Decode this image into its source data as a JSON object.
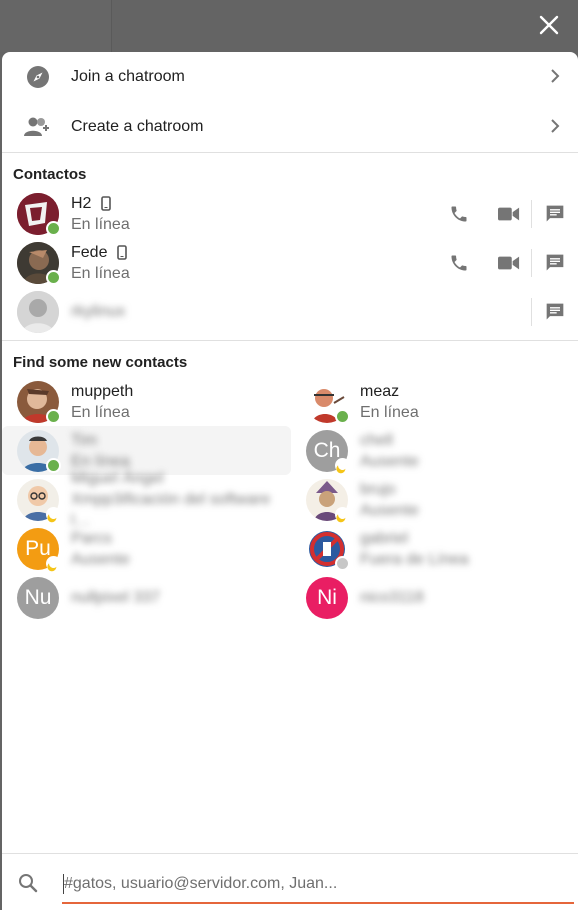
{
  "window": {
    "close_icon": "close-icon"
  },
  "actions": [
    {
      "label": "Join a chatroom",
      "icon": "compass-icon"
    },
    {
      "label": "Create a chatroom",
      "icon": "add-group-icon"
    }
  ],
  "contacts": {
    "title": "Contactos",
    "items": [
      {
        "name": "H2",
        "status_text": "En línea",
        "status": "online",
        "mobile": true,
        "avatar_color": "#7b1e2e"
      },
      {
        "name": "Fede",
        "status_text": "En línea",
        "status": "online",
        "mobile": true,
        "avatar_color": "#5a4a3a"
      },
      {
        "name": "rkylinux",
        "status_text": "",
        "status": "none",
        "mobile": false,
        "avatar_color": "#b5b5b5"
      }
    ]
  },
  "new_contacts": {
    "title": "Find some new contacts",
    "items": [
      {
        "name": "muppeth",
        "status_text": "En línea",
        "status": "online",
        "avatar_text": "",
        "avatar_color": "#8a5a3c",
        "blurred": false
      },
      {
        "name": "meaz",
        "status_text": "En línea",
        "status": "online",
        "avatar_text": "",
        "avatar_color": "#f0e6dc",
        "blurred": false
      },
      {
        "name": "Tim",
        "status_text": "En línea",
        "status": "online",
        "avatar_text": "",
        "avatar_color": "#d7dde3",
        "blurred": true
      },
      {
        "name": "chell",
        "status_text": "Ausente",
        "status": "away",
        "avatar_text": "Ch",
        "avatar_color": "#9e9e9e",
        "blurred": true
      },
      {
        "name": "Miguel Ángel",
        "status_text": "Xmpp3ificación del software l…",
        "status": "away",
        "avatar_text": "",
        "avatar_color": "#e8e4dc",
        "blurred": true
      },
      {
        "name": "brujo",
        "status_text": "Ausente",
        "status": "away",
        "avatar_text": "",
        "avatar_color": "#e9e1d4",
        "blurred": true
      },
      {
        "name": "Parcs",
        "status_text": "Ausente",
        "status": "away",
        "avatar_text": "Pu",
        "avatar_color": "#f39c12",
        "blurred": true
      },
      {
        "name": "gabriel",
        "status_text": "Fuera de Línea",
        "status": "offline",
        "avatar_text": "",
        "avatar_color": "#c0392b",
        "blurred": true
      },
      {
        "name": "nullpixel 337",
        "status_text": "",
        "status": "none",
        "avatar_text": "Nu",
        "avatar_color": "#9e9e9e",
        "blurred": true
      },
      {
        "name": "nico3118",
        "status_text": "",
        "status": "none",
        "avatar_text": "Ni",
        "avatar_color": "#e91e63",
        "blurred": true
      }
    ]
  },
  "search": {
    "placeholder": "#gatos, usuario@servidor.com, Juan...",
    "icon": "search-icon"
  },
  "colors": {
    "accent": "#e5663b",
    "online": "#6ab04c",
    "away": "#f5c518",
    "offline": "#c7c7c7"
  }
}
